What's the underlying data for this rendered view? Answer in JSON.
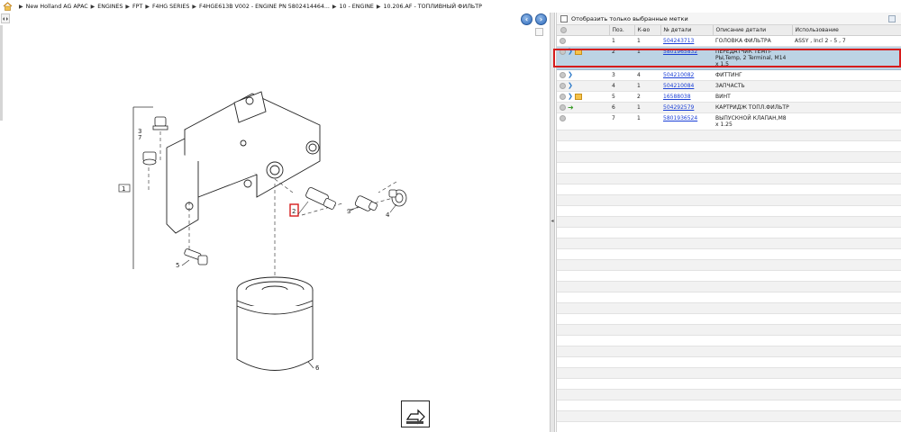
{
  "breadcrumb": {
    "items": [
      "New Holland AG APAC",
      "ENGINES",
      "FPT",
      "F4HG SERIES",
      "F4HGE613B V002 - ENGINE PN 5802414464...",
      "10 - ENGINE",
      "10.206.AF - ТОПЛИВНЫЙ ФИЛЬТР"
    ]
  },
  "diagram": {
    "callouts": [
      "1",
      "2",
      "3",
      "4",
      "3",
      "7",
      "5",
      "6"
    ]
  },
  "right_panel": {
    "filter_label": "Отобразить только выбранные метки",
    "columns": [
      "Поз.",
      "К-во",
      "№ детали",
      "Описание детали",
      "Использование"
    ],
    "rows": [
      {
        "pos": "1",
        "qty": "1",
        "part": "504243713",
        "desc": "ГОЛОВКА ФИЛЬТРА",
        "usage": "ASSY , Incl 2 - 5 , 7",
        "icons": [
          "circle"
        ]
      },
      {
        "pos": "2",
        "qty": "1",
        "part": "5801965832",
        "desc": "ПЕРЕДАТЧИК ТЕМП-РЫ,Temp, 2 Terminal, M14 x 1.5",
        "usage": "",
        "icons": [
          "circle",
          "info",
          "box"
        ]
      },
      {
        "pos": "3",
        "qty": "4",
        "part": "504210082",
        "desc": "ФИТТИНГ",
        "usage": "",
        "icons": [
          "circle",
          "info"
        ]
      },
      {
        "pos": "4",
        "qty": "1",
        "part": "504210084",
        "desc": "ЗАПЧАСТЬ",
        "usage": "",
        "icons": [
          "circle",
          "info"
        ]
      },
      {
        "pos": "5",
        "qty": "2",
        "part": "16588038",
        "desc": "ВИНТ",
        "usage": "",
        "icons": [
          "circle",
          "info",
          "box"
        ]
      },
      {
        "pos": "6",
        "qty": "1",
        "part": "504292579",
        "desc": "КАРТРИДЖ ТОПЛ.ФИЛЬТР",
        "usage": "",
        "icons": [
          "circle",
          "arrow"
        ]
      },
      {
        "pos": "7",
        "qty": "1",
        "part": "5801936524",
        "desc": "ВЫПУСКНОЙ КЛАПАН,M8 x 1.25",
        "usage": "",
        "icons": [
          "circle"
        ]
      }
    ],
    "selected_row": 1
  },
  "colors": {
    "link": "#1a3fd6",
    "selected_row_bg": "#bcd3e4",
    "highlight_outline": "#d61c1c"
  }
}
